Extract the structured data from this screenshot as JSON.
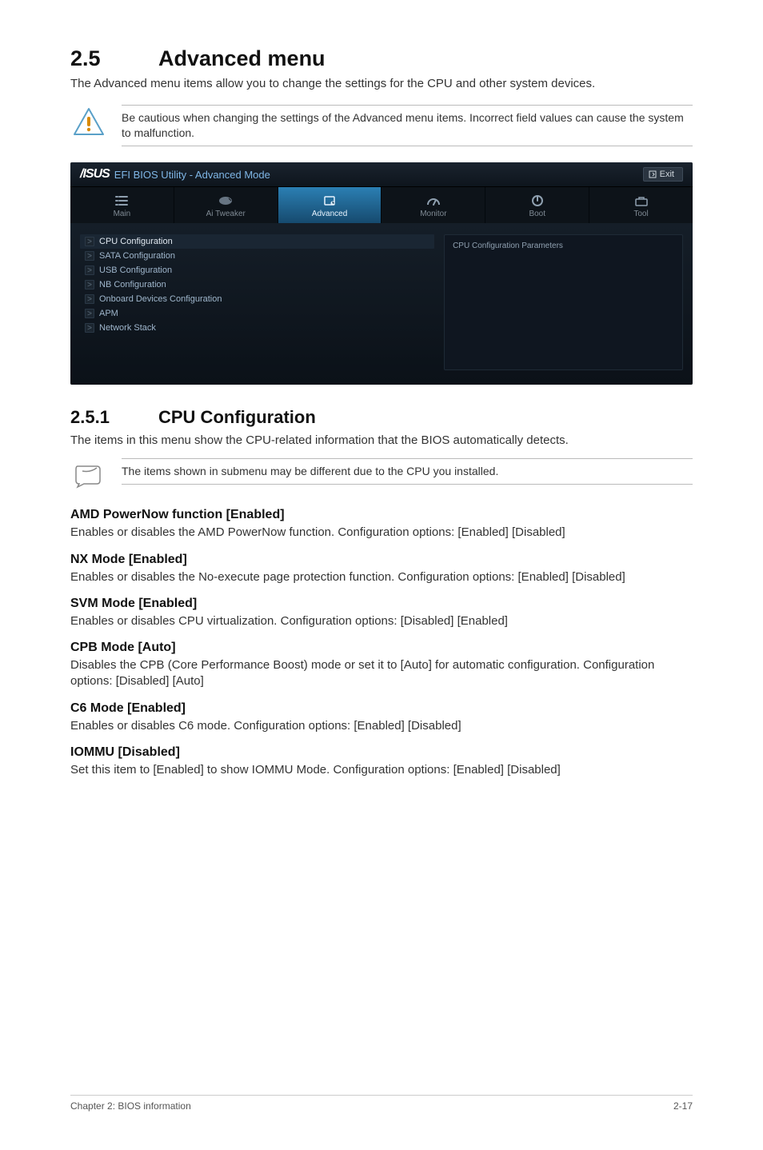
{
  "section": {
    "number": "2.5",
    "title": "Advanced menu"
  },
  "intro": "The Advanced menu items allow you to change the settings for the CPU and other system devices.",
  "caution": "Be cautious when changing the settings of the Advanced menu items. Incorrect field values can cause the system to malfunction.",
  "bios": {
    "logo_mark": "/ISUS",
    "logo_text": "EFI BIOS Utility - Advanced Mode",
    "exit_label": "Exit",
    "tabs": [
      {
        "label": "Main"
      },
      {
        "label": "Ai  Tweaker"
      },
      {
        "label": "Advanced"
      },
      {
        "label": "Monitor"
      },
      {
        "label": "Boot"
      },
      {
        "label": "Tool"
      }
    ],
    "items": [
      {
        "label": "CPU Configuration",
        "selected": true
      },
      {
        "label": "SATA Configuration"
      },
      {
        "label": "USB Configuration"
      },
      {
        "label": "NB Configuration"
      },
      {
        "label": "Onboard Devices Configuration"
      },
      {
        "label": "APM"
      },
      {
        "label": "Network Stack"
      }
    ],
    "help_panel": "CPU Configuration Parameters"
  },
  "subsection": {
    "number": "2.5.1",
    "title": "CPU Configuration"
  },
  "subsection_intro": "The items in this menu show the CPU-related information that the BIOS automatically detects.",
  "note": "The items shown in submenu may be different due to the CPU you installed.",
  "options": [
    {
      "title": "AMD PowerNow function [Enabled]",
      "body": "Enables or disables the AMD PowerNow function. Configuration options: [Enabled] [Disabled]"
    },
    {
      "title": "NX Mode [Enabled]",
      "body": "Enables or disables the No-execute page protection function. Configuration options: [Enabled] [Disabled]"
    },
    {
      "title": "SVM Mode [Enabled]",
      "body": "Enables or disables CPU virtualization. Configuration options: [Disabled] [Enabled]"
    },
    {
      "title": "CPB Mode [Auto]",
      "body": "Disables the CPB (Core Performance Boost) mode or set it to [Auto] for automatic configuration. Configuration options: [Disabled] [Auto]"
    },
    {
      "title": "C6 Mode [Enabled]",
      "body": "Enables or disables C6 mode. Configuration options: [Enabled] [Disabled]"
    },
    {
      "title": "IOMMU [Disabled]",
      "body": "Set this item to [Enabled] to show IOMMU Mode. Configuration options: [Enabled] [Disabled]"
    }
  ],
  "footer": {
    "left": "Chapter 2: BIOS information",
    "right": "2-17"
  }
}
